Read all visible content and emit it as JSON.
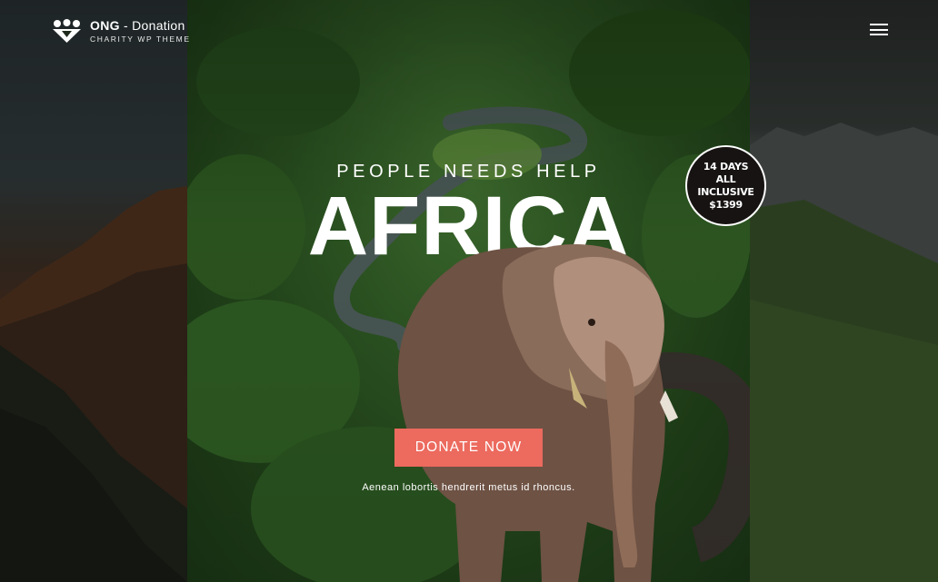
{
  "brand": {
    "name_bold": "ONG",
    "name_rest": " - Donation",
    "tagline": "CHARITY WP THEME"
  },
  "header": {
    "menu_icon": "hamburger-icon"
  },
  "hero": {
    "kicker": "PEOPLE NEEDS HELP",
    "title": "AFRICA",
    "cta_label": "DONATE NOW",
    "caption": "Aenean lobortis hendrerit metus id rhoncus."
  },
  "badge": {
    "line1": "14 DAYS",
    "line2": "ALL INCLUSIVE",
    "line3": "$1399"
  },
  "colors": {
    "accent": "#ec6a5e",
    "badge_bg": "#161312",
    "text": "#ffffff"
  }
}
